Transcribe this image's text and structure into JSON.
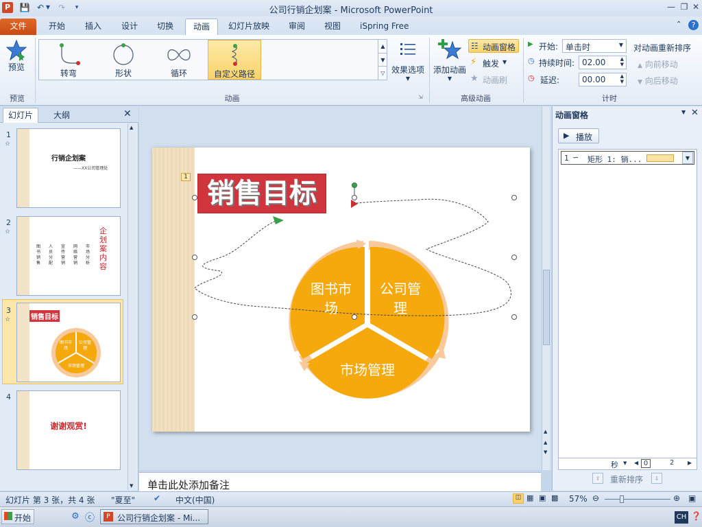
{
  "window": {
    "title": "公司行销企划案 - Microsoft PowerPoint",
    "app_icon_letter": "P"
  },
  "tabs": {
    "file": "文件",
    "items": [
      "开始",
      "插入",
      "设计",
      "切换",
      "动画",
      "幻灯片放映",
      "审阅",
      "视图",
      "iSpring Free"
    ],
    "active": "动画"
  },
  "ribbon": {
    "preview": {
      "label": "预览",
      "group": "预览"
    },
    "animation_gallery": {
      "items": [
        {
          "label": "转弯",
          "icon": "turn-path-icon"
        },
        {
          "label": "形状",
          "icon": "shape-path-icon"
        },
        {
          "label": "循环",
          "icon": "loop-path-icon"
        },
        {
          "label": "自定义路径",
          "icon": "custom-path-icon"
        }
      ],
      "selected": "自定义路径",
      "effect_options": "效果选项",
      "group": "动画"
    },
    "advanced": {
      "add_animation": "添加动画",
      "anim_pane": "动画窗格",
      "trigger": "触发",
      "anim_painter": "动画刷",
      "group": "高级动画"
    },
    "timing": {
      "start_label": "开始:",
      "start_value": "单击时",
      "duration_label": "持续时间:",
      "duration_value": "02.00",
      "delay_label": "延迟:",
      "delay_value": "00.00",
      "reorder_title": "对动画重新排序",
      "move_earlier": "向前移动",
      "move_later": "向后移动",
      "group": "计时"
    }
  },
  "left_panel": {
    "tab_slides": "幻灯片",
    "tab_outline": "大纲",
    "thumbs": [
      {
        "num": "1",
        "title": "行销企划案",
        "sub": "——XX公司管理处"
      },
      {
        "num": "2",
        "title": "企划案内容",
        "columns": [
          "图书销售",
          "人员分配",
          "宣传营销",
          "网络营销",
          "市场分析"
        ]
      },
      {
        "num": "3",
        "title": "销售目标",
        "parts": [
          "图书市场",
          "公司管理",
          "市场管理"
        ]
      },
      {
        "num": "4",
        "title": "谢谢观赏!"
      }
    ],
    "current": "3"
  },
  "slide": {
    "title": "销售目标",
    "anim_tag": "1",
    "segments": {
      "left": "图书市场",
      "right": "公司管理",
      "bottom": "市场管理"
    },
    "colors": {
      "pie": "#f5a90c",
      "ring": "#f7c99b",
      "title_bg": "#d0343d",
      "strip": "#f2e0c2"
    }
  },
  "notes": {
    "placeholder": "单击此处添加备注"
  },
  "anim_pane": {
    "title": "动画窗格",
    "play": "播放",
    "items": [
      {
        "index": "1",
        "text": "矩形 1: 销..."
      }
    ],
    "seconds_label": "秒",
    "timeline_start": "0",
    "timeline_end": "2",
    "reorder": "重新排序"
  },
  "status": {
    "slide_info": "幻灯片 第 3 张，共 4 张",
    "theme": "\"夏至\"",
    "language": "中文(中国)",
    "zoom": "57%"
  },
  "taskbar": {
    "start": "开始",
    "task": "公司行销企划案 - Mi...",
    "ime": "CH"
  }
}
